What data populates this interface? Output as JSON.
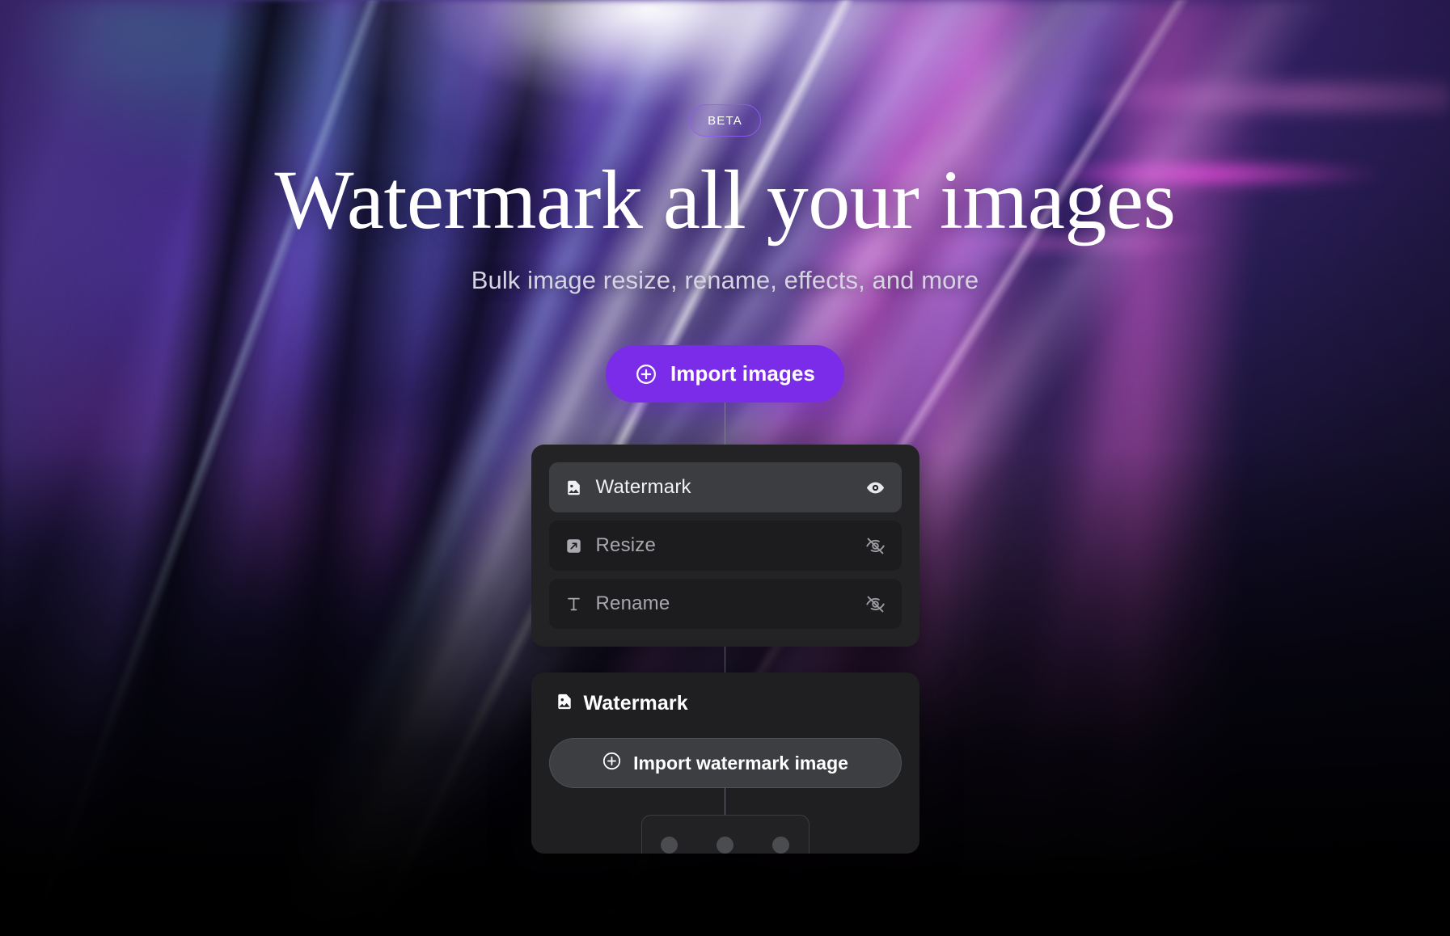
{
  "hero": {
    "badge": "BETA",
    "title": "Watermark all your images",
    "subtitle": "Bulk image resize, rename, effects, and more",
    "import_button": "Import images",
    "plus_icon": "plus-circle-icon"
  },
  "options_panel": {
    "rows": [
      {
        "label": "Watermark",
        "icon": "image-watermark-icon",
        "visibility": "visible",
        "eye_icon": "eye-icon",
        "active": true
      },
      {
        "label": "Resize",
        "icon": "resize-arrow-icon",
        "visibility": "hidden",
        "eye_icon": "eye-slash-icon",
        "active": false
      },
      {
        "label": "Rename",
        "icon": "text-type-icon",
        "visibility": "hidden",
        "eye_icon": "eye-slash-icon",
        "active": false
      }
    ]
  },
  "watermark_panel": {
    "title": "Watermark",
    "title_icon": "image-watermark-icon",
    "import_button": "Import watermark image",
    "plus_icon": "plus-circle-icon",
    "position_dots": [
      "position-dot-left",
      "position-dot-center",
      "position-dot-right"
    ]
  },
  "colors": {
    "accent_purple": "#7b2ce8",
    "badge_border": "#965af5",
    "panel_bg": "#232326",
    "panel2_bg": "#1f1f22",
    "row_active_bg": "#3b3d41",
    "row_inactive_bg": "#1c1c1e",
    "button_secondary_bg": "#3c3e42",
    "text_primary": "#ffffff",
    "text_muted": "#a7a7ad",
    "subtitle": "#d6d4e2"
  }
}
